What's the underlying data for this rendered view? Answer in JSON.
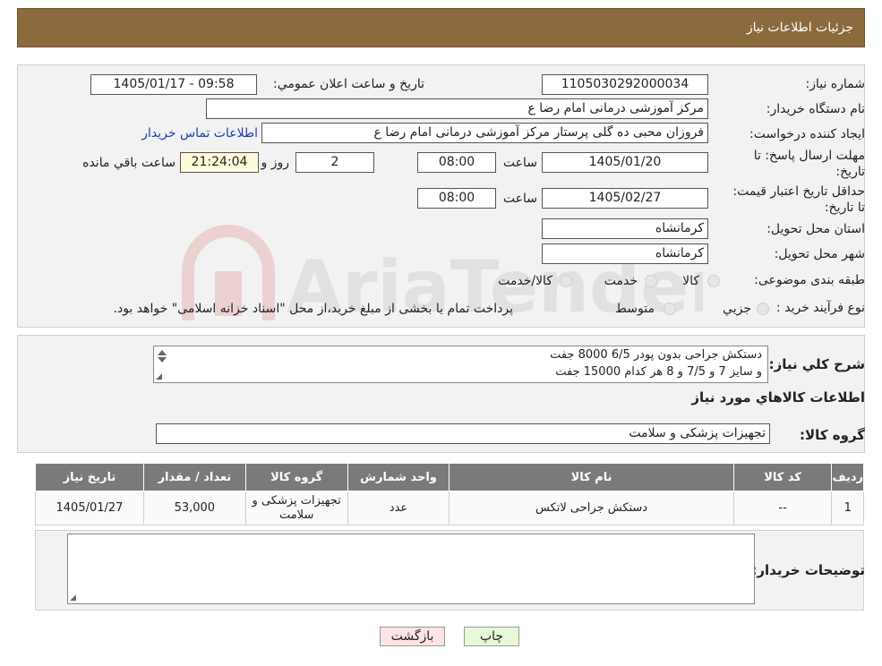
{
  "header": {
    "title": "جزئیات اطلاعات نیاز"
  },
  "fields": {
    "need_number_label": "شماره نیاز:",
    "need_number": "1105030292000034",
    "announce_label": "تاریخ و ساعت اعلان عمومي:",
    "announce_value": "1405/01/17 - 09:58",
    "buyer_org_label": "نام دستگاه خریدار:",
    "buyer_org": "مرکز آموزشی  درمانی امام رضا  ع",
    "creator_label": "ایجاد کننده درخواست:",
    "creator": "فروزان محبی ده گلی پرستار مرکز آموزشی  درمانی امام رضا  ع",
    "contact_link": "اطلاعات تماس خریدار",
    "deadline_label": "مهلت ارسال پاسخ: تا تاریخ:",
    "deadline_date": "1405/01/20",
    "time_label": "ساعت",
    "deadline_time": "08:00",
    "days_value": "2",
    "days_label": "روز و",
    "remaining_time": "21:24:04",
    "remaining_label": "ساعت باقي مانده",
    "validity_label": "حداقل تاریخ اعتبار قیمت: تا تاریخ:",
    "validity_date": "1405/02/27",
    "validity_time": "08:00",
    "province_label": "استان محل تحویل:",
    "province": "کرمانشاه",
    "city_label": "شهر محل تحویل:",
    "city": "کرمانشاه",
    "category_label": "طبقه بندی موضوعی:",
    "category_options": [
      "کالا",
      "خدمت",
      "کالا/خدمت"
    ],
    "process_label": "نوع فرآیند خرید :",
    "process_options": [
      "جزيي",
      "متوسط"
    ],
    "process_note": "پرداخت تمام یا بخشی از مبلغ خرید،از محل \"اسناد خزانه اسلامی\" خواهد بود."
  },
  "description": {
    "label": "شرح کلي نیاز:",
    "line1": "دستکش جراحی بدون پودر     6/5     8000 جفت",
    "line2": "و سایز   7 و 7/5 و 8    هر کدام    15000 جفت"
  },
  "goods": {
    "section_title": "اطلاعات کالاهاي مورد نیاز",
    "group_label": "گروه کالا:",
    "group_value": "تجهیزات پزشکی و سلامت",
    "columns": [
      "ردیف",
      "کد کالا",
      "نام کالا",
      "واحد شمارش",
      "گروه کالا",
      "تعداد / مقدار",
      "تاریخ نیاز"
    ],
    "rows": [
      {
        "row": "1",
        "code": "--",
        "name": "دستکش جراحی لاتکس",
        "unit": "عدد",
        "group": "تجهیزات پزشکی و سلامت",
        "qty": "53,000",
        "date": "1405/01/27"
      }
    ]
  },
  "buyer_notes": {
    "label": "توضیحات خریدار:",
    "value": ""
  },
  "buttons": {
    "print": "چاپ",
    "back": "بازگشت"
  },
  "watermark": {
    "text": "AriaTender.neT"
  },
  "colors": {
    "header": "#8b6a3d",
    "back_button": "#fde3e3",
    "print_button": "#e6f9d8",
    "yellow_box": "#fefbdc"
  }
}
